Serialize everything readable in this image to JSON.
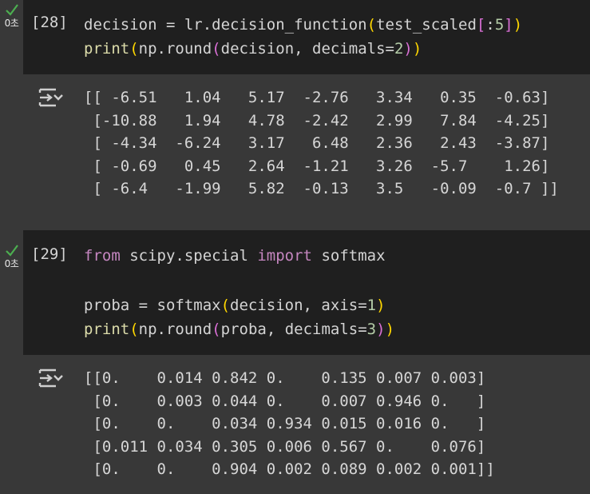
{
  "cells": [
    {
      "exec_count": "[28]",
      "status_time": "0초",
      "code_lines": [
        [
          {
            "t": "decision = lr.decision_function",
            "c": "default"
          },
          {
            "t": "(",
            "c": "paren1"
          },
          {
            "t": "test_scaled",
            "c": "default"
          },
          {
            "t": "[",
            "c": "paren2"
          },
          {
            "t": ":",
            "c": "default"
          },
          {
            "t": "5",
            "c": "num"
          },
          {
            "t": "]",
            "c": "paren2"
          },
          {
            "t": ")",
            "c": "paren1"
          }
        ],
        [
          {
            "t": "print",
            "c": "func"
          },
          {
            "t": "(",
            "c": "paren1"
          },
          {
            "t": "np.round",
            "c": "default"
          },
          {
            "t": "(",
            "c": "paren2"
          },
          {
            "t": "decision, decimals=",
            "c": "default"
          },
          {
            "t": "2",
            "c": "num"
          },
          {
            "t": ")",
            "c": "paren2"
          },
          {
            "t": ")",
            "c": "paren1"
          }
        ]
      ],
      "output_lines": [
        "[[ -6.51   1.04   5.17  -2.76   3.34   0.35  -0.63]",
        " [-10.88   1.94   4.78  -2.42   2.99   7.84  -4.25]",
        " [ -4.34  -6.24   3.17   6.48   2.36   2.43  -3.87]",
        " [ -0.69   0.45   2.64  -1.21   3.26  -5.7    1.26]",
        " [ -6.4   -1.99   5.82  -0.13   3.5   -0.09  -0.7 ]]"
      ]
    },
    {
      "exec_count": "[29]",
      "status_time": "0초",
      "code_lines": [
        [
          {
            "t": "from",
            "c": "kw"
          },
          {
            "t": " scipy.special ",
            "c": "default"
          },
          {
            "t": "import",
            "c": "kw"
          },
          {
            "t": " softmax",
            "c": "default"
          }
        ],
        [],
        [
          {
            "t": "proba = softmax",
            "c": "default"
          },
          {
            "t": "(",
            "c": "paren1"
          },
          {
            "t": "decision, axis=",
            "c": "default"
          },
          {
            "t": "1",
            "c": "num"
          },
          {
            "t": ")",
            "c": "paren1"
          }
        ],
        [
          {
            "t": "print",
            "c": "func"
          },
          {
            "t": "(",
            "c": "paren1"
          },
          {
            "t": "np.round",
            "c": "default"
          },
          {
            "t": "(",
            "c": "paren2"
          },
          {
            "t": "proba, decimals=",
            "c": "default"
          },
          {
            "t": "3",
            "c": "num"
          },
          {
            "t": ")",
            "c": "paren2"
          },
          {
            "t": ")",
            "c": "paren1"
          }
        ]
      ],
      "output_lines": [
        "[[0.    0.014 0.842 0.    0.135 0.007 0.003]",
        " [0.    0.003 0.044 0.    0.007 0.946 0.   ]",
        " [0.    0.    0.034 0.934 0.015 0.016 0.   ]",
        " [0.011 0.034 0.305 0.006 0.567 0.    0.076]",
        " [0.    0.    0.904 0.002 0.089 0.002 0.001]]"
      ]
    }
  ],
  "icons": {
    "status": "check-icon",
    "output": "output-toggle-icon"
  },
  "colors": {
    "background": "#383838",
    "code_background": "#1f1f1f",
    "success_check": "#4caf50",
    "function": "#dcdcaa",
    "keyword": "#c586c0",
    "number": "#b5cea8",
    "paren_level1": "#ffd700",
    "paren_level2": "#da70d6"
  }
}
